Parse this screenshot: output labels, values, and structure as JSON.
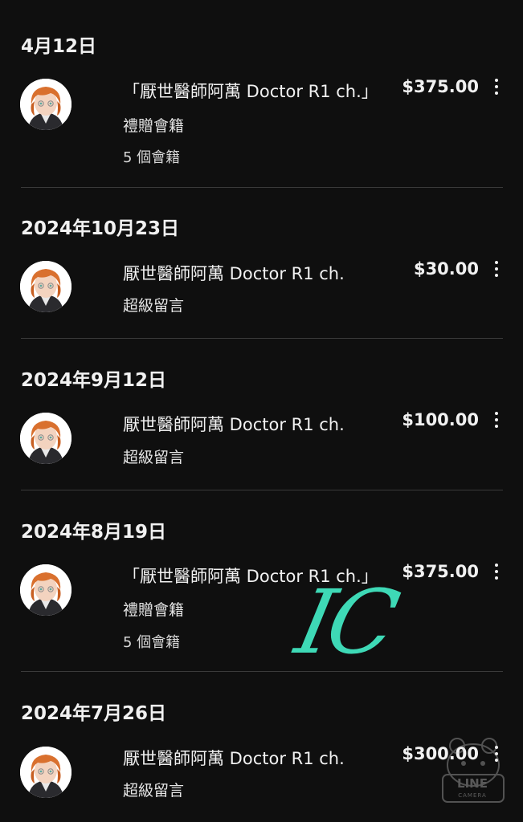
{
  "groups": [
    {
      "date": "4月12日",
      "item": {
        "title": "「厭世醫師阿萬 Doctor R1 ch.」",
        "type": "禮贈會籍",
        "count": "5 個會籍",
        "amount": "$375.00"
      }
    },
    {
      "date": "2024年10月23日",
      "item": {
        "title": "厭世醫師阿萬 Doctor R1 ch.",
        "type": "超級留言",
        "amount": "$30.00"
      }
    },
    {
      "date": "2024年9月12日",
      "item": {
        "title": "厭世醫師阿萬 Doctor R1 ch.",
        "type": "超級留言",
        "amount": "$100.00"
      }
    },
    {
      "date": "2024年8月19日",
      "item": {
        "title": "「厭世醫師阿萬 Doctor R1 ch.」",
        "type": "禮贈會籍",
        "count": "5 個會籍",
        "amount": "$375.00"
      }
    },
    {
      "date": "2024年7月26日",
      "item": {
        "title": "厭世醫師阿萬 Doctor R1 ch.",
        "type": "超級留言",
        "amount": "$300.00"
      }
    }
  ],
  "watermark": {
    "text": "IC",
    "color": "#3ed9b6"
  },
  "camera_logo": {
    "brand": "LINE",
    "label": "CAMERA"
  },
  "icons": {
    "more": "more-vertical-icon",
    "avatar": "channel-avatar"
  },
  "colors": {
    "background": "#0f0f0f",
    "text": "#f1f1f1",
    "divider": "#3a3a3a"
  }
}
